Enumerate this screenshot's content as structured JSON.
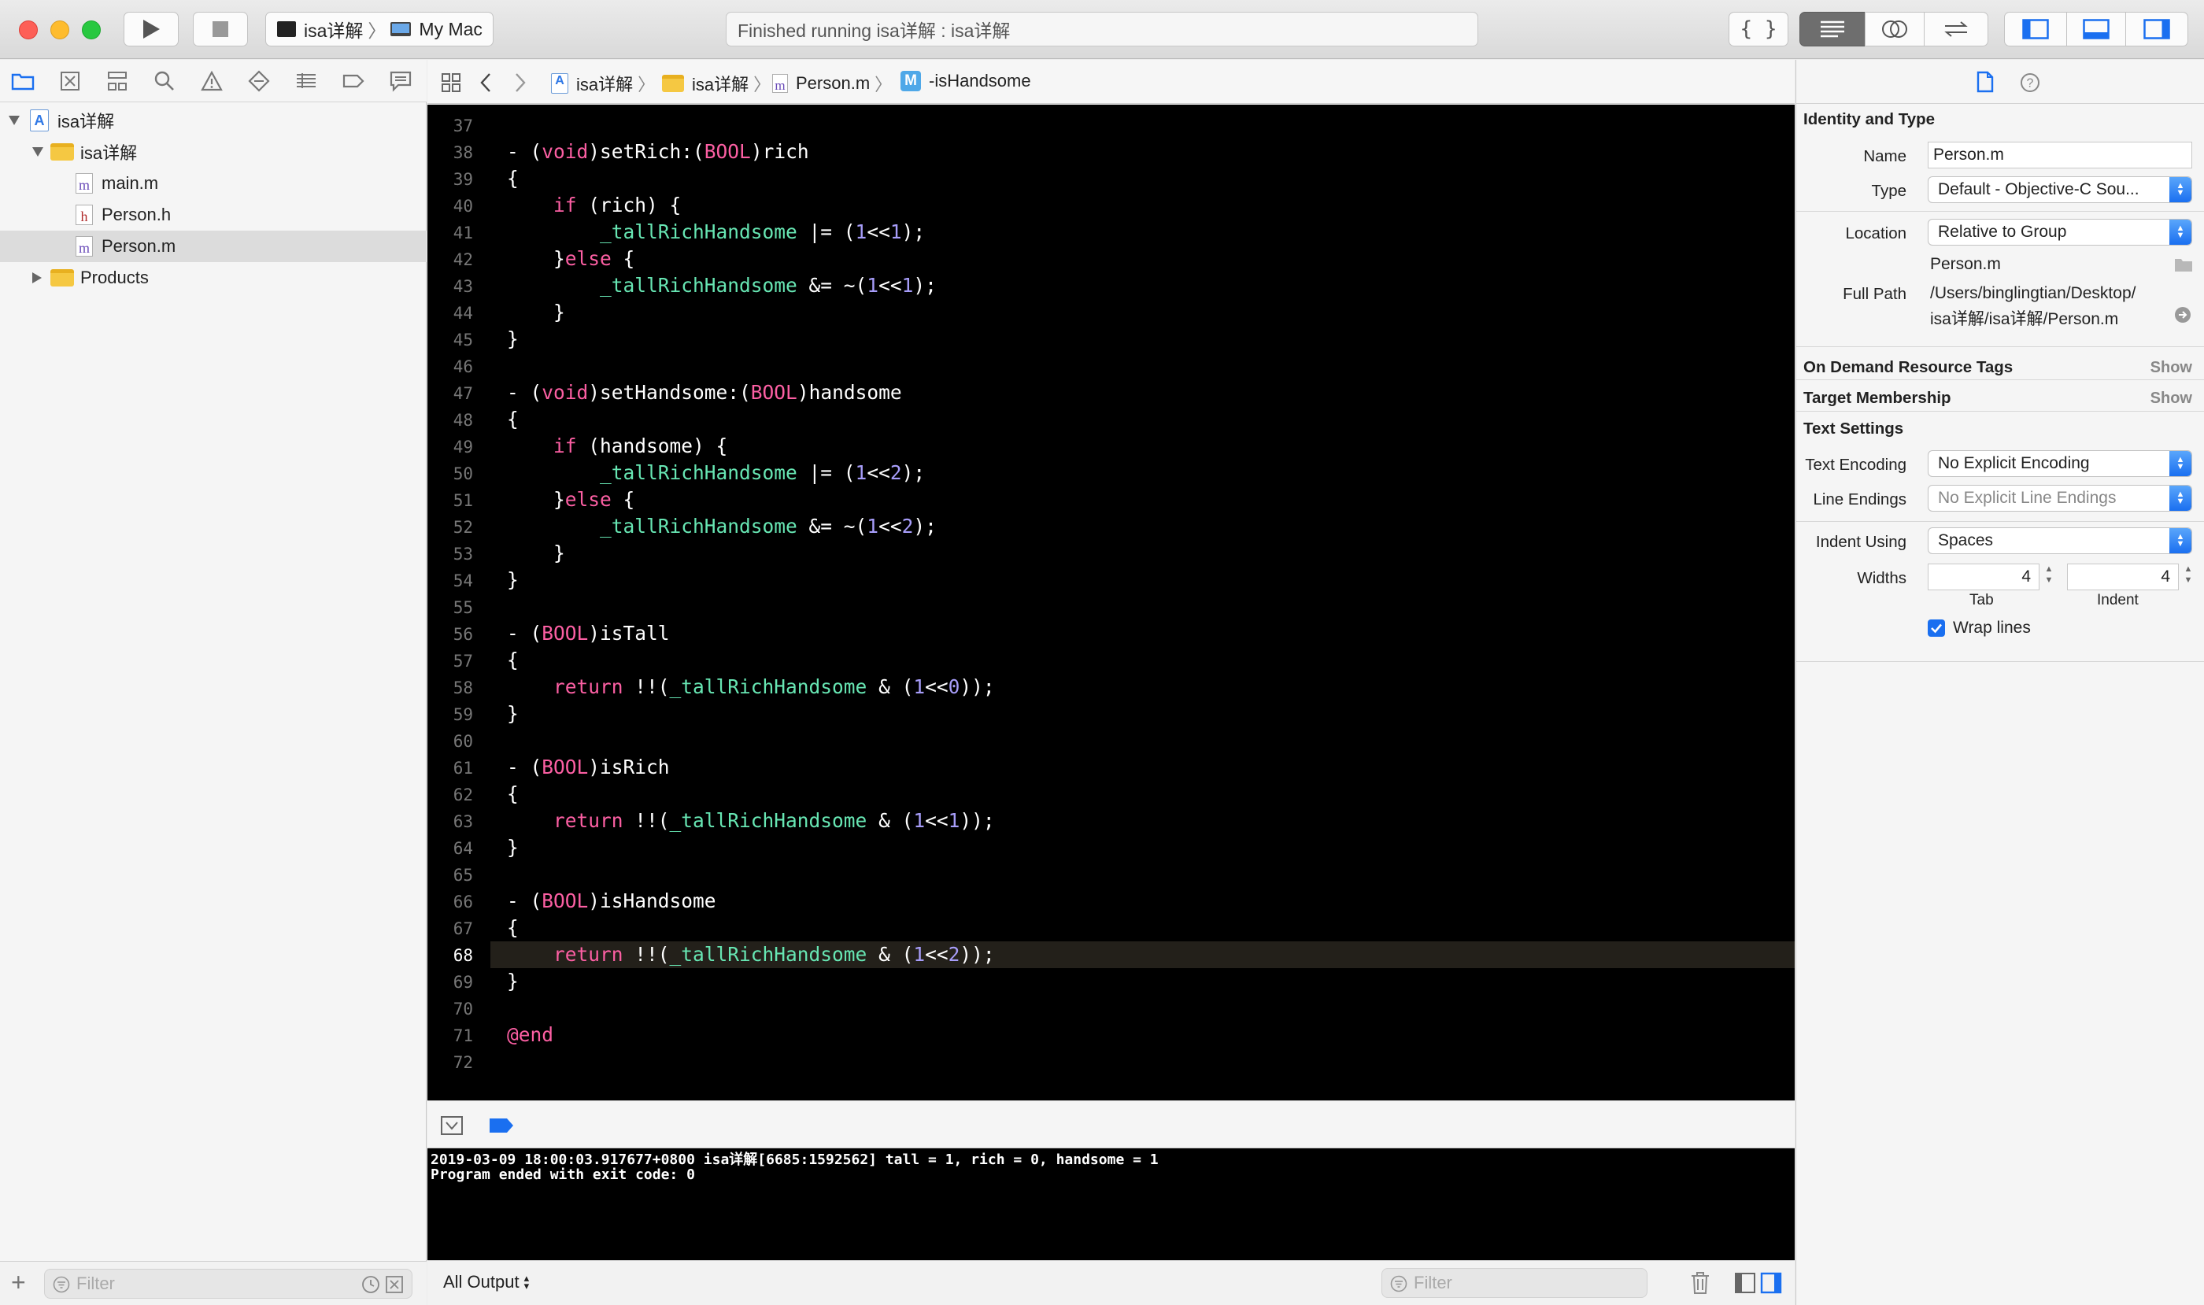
{
  "toolbar": {
    "scheme_target": "isa详解",
    "scheme_device": "My Mac",
    "activity_status": "Finished running isa详解 : isa详解"
  },
  "navigator": {
    "project_name": "isa详解",
    "group_name": "isa详解",
    "files": [
      "main.m",
      "Person.h",
      "Person.m"
    ],
    "products_label": "Products",
    "filter_placeholder": "Filter"
  },
  "jumpbar": {
    "crumbs": [
      "isa详解",
      "isa详解",
      "Person.m",
      "-isHandsome"
    ]
  },
  "editor": {
    "line_numbers": [
      "37",
      "38",
      "39",
      "40",
      "41",
      "42",
      "43",
      "44",
      "45",
      "46",
      "47",
      "48",
      "49",
      "50",
      "51",
      "52",
      "53",
      "54",
      "55",
      "56",
      "57",
      "58",
      "59",
      "60",
      "61",
      "62",
      "63",
      "64",
      "65",
      "66",
      "67",
      "68",
      "69",
      "70",
      "71",
      "72"
    ],
    "current_line": "68",
    "code_lines": [
      "",
      "- (void)setRich:(BOOL)rich",
      "{",
      "    if (rich) {",
      "        _tallRichHandsome |= (1<<1);",
      "    }else {",
      "        _tallRichHandsome &= ~(1<<1);",
      "    }",
      "}",
      "",
      "- (void)setHandsome:(BOOL)handsome",
      "{",
      "    if (handsome) {",
      "        _tallRichHandsome |= (1<<2);",
      "    }else {",
      "        _tallRichHandsome &= ~(1<<2);",
      "    }",
      "}",
      "",
      "- (BOOL)isTall",
      "{",
      "    return !!(_tallRichHandsome & (1<<0));",
      "}",
      "",
      "- (BOOL)isRich",
      "{",
      "    return !!(_tallRichHandsome & (1<<1));",
      "}",
      "",
      "- (BOOL)isHandsome",
      "{",
      "    return !!(_tallRichHandsome & (1<<2));",
      "}",
      "",
      "@end",
      ""
    ]
  },
  "console": {
    "lines": [
      "2019-03-09 18:00:03.917677+0800 isa详解[6685:1592562] tall = 1, rich = 0, handsome = 1",
      "Program ended with exit code: 0"
    ],
    "output_selector": "All Output",
    "filter_placeholder": "Filter"
  },
  "inspector": {
    "identity_title": "Identity and Type",
    "name_label": "Name",
    "name_value": "Person.m",
    "type_label": "Type",
    "type_value": "Default - Objective-C Sou...",
    "location_label": "Location",
    "location_value": "Relative to Group",
    "location_file": "Person.m",
    "fullpath_label": "Full Path",
    "fullpath_line1": "/Users/binglingtian/Desktop/",
    "fullpath_line2": "isa详解/isa详解/Person.m",
    "odr_title": "On Demand Resource Tags",
    "odr_show": "Show",
    "target_title": "Target Membership",
    "target_show": "Show",
    "text_settings_title": "Text Settings",
    "encoding_label": "Text Encoding",
    "encoding_value": "No Explicit Encoding",
    "line_endings_label": "Line Endings",
    "line_endings_value": "No Explicit Line Endings",
    "indent_label": "Indent Using",
    "indent_value": "Spaces",
    "widths_label": "Widths",
    "tab_value": "4",
    "indent_width_value": "4",
    "tab_caption": "Tab",
    "indent_caption": "Indent",
    "wrap_label": "Wrap lines",
    "wrap_checked": true
  },
  "colors": {
    "keyword": "#fc5fa3",
    "ivar": "#67e6b3",
    "number": "#a79df9",
    "accent": "#1a6ff0"
  }
}
